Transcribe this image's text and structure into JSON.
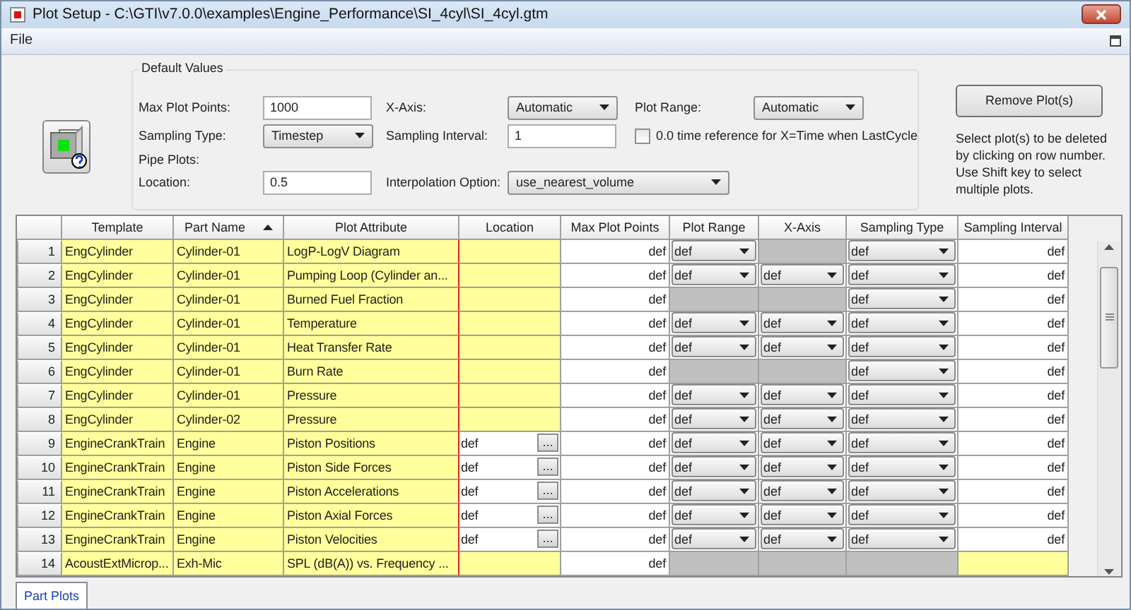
{
  "window": {
    "title": "Plot Setup - C:\\GTI\\v7.0.0\\examples\\Engine_Performance\\SI_4cyl\\SI_4cyl.gtm"
  },
  "menu": [
    "File"
  ],
  "default_values": {
    "title": "Default Values",
    "rows": [
      [
        {
          "kind": "input",
          "label": "Max Plot Points:",
          "value": "1000"
        },
        {
          "kind": "combo",
          "label": "X-Axis:",
          "value": "Automatic"
        },
        {
          "kind": "combo",
          "label": "Plot Range:",
          "value": "Automatic"
        }
      ],
      [
        {
          "kind": "combo",
          "label": "Sampling Type:",
          "value": "Timestep"
        },
        {
          "kind": "input",
          "label": "Sampling Interval:",
          "value": "1"
        },
        {
          "kind": "checkbox",
          "label": "0.0 time reference for X=Time when LastCycle",
          "checked": false
        }
      ],
      [
        {
          "kind": "heading",
          "label": "Pipe Plots:"
        }
      ],
      [
        {
          "kind": "input",
          "label": "Location:",
          "value": "0.5"
        },
        {
          "kind": "combo",
          "label": "Interpolation Option:",
          "value": "use_nearest_volume"
        }
      ]
    ]
  },
  "remove_button": "Remove Plot(s)",
  "help_text": "Select plot(s) to be deleted by clicking on row number. Use Shift key to select multiple plots.",
  "table": {
    "columns": [
      {
        "label": "Template",
        "sorted": false
      },
      {
        "label": "Part Name",
        "sorted": true
      },
      {
        "label": "Plot Attribute",
        "sorted": false
      },
      {
        "label": "Location",
        "sorted": false
      },
      {
        "label": "Max Plot Points",
        "sorted": false
      },
      {
        "label": "Plot Range",
        "sorted": false
      },
      {
        "label": "X-Axis",
        "sorted": false
      },
      {
        "label": "Sampling Type",
        "sorted": false
      },
      {
        "label": "Sampling Interval",
        "sorted": false
      }
    ],
    "rows": [
      {
        "number": "1",
        "cells": [
          {
            "kind": "text",
            "text": "EngCylinder"
          },
          {
            "kind": "text",
            "text": "Cylinder-01"
          },
          {
            "kind": "text",
            "text": "LogP-LogV Diagram"
          },
          {
            "kind": "empty"
          },
          {
            "kind": "number",
            "text": "def"
          },
          {
            "kind": "combo",
            "text": "def"
          },
          {
            "kind": "disabled"
          },
          {
            "kind": "combo",
            "text": "def"
          },
          {
            "kind": "number",
            "text": "def"
          }
        ]
      },
      {
        "number": "2",
        "cells": [
          {
            "kind": "text",
            "text": "EngCylinder"
          },
          {
            "kind": "text",
            "text": "Cylinder-01"
          },
          {
            "kind": "text",
            "text": "Pumping Loop (Cylinder an..."
          },
          {
            "kind": "empty"
          },
          {
            "kind": "number",
            "text": "def"
          },
          {
            "kind": "combo",
            "text": "def"
          },
          {
            "kind": "combo",
            "text": "def"
          },
          {
            "kind": "combo",
            "text": "def"
          },
          {
            "kind": "number",
            "text": "def"
          }
        ]
      },
      {
        "number": "3",
        "cells": [
          {
            "kind": "text",
            "text": "EngCylinder"
          },
          {
            "kind": "text",
            "text": "Cylinder-01"
          },
          {
            "kind": "text",
            "text": "Burned Fuel Fraction"
          },
          {
            "kind": "empty"
          },
          {
            "kind": "number",
            "text": "def"
          },
          {
            "kind": "disabled"
          },
          {
            "kind": "disabled"
          },
          {
            "kind": "combo",
            "text": "def"
          },
          {
            "kind": "number",
            "text": "def"
          }
        ]
      },
      {
        "number": "4",
        "cells": [
          {
            "kind": "text",
            "text": "EngCylinder"
          },
          {
            "kind": "text",
            "text": "Cylinder-01"
          },
          {
            "kind": "text",
            "text": "Temperature"
          },
          {
            "kind": "empty"
          },
          {
            "kind": "number",
            "text": "def"
          },
          {
            "kind": "combo",
            "text": "def"
          },
          {
            "kind": "combo",
            "text": "def"
          },
          {
            "kind": "combo",
            "text": "def"
          },
          {
            "kind": "number",
            "text": "def"
          }
        ]
      },
      {
        "number": "5",
        "cells": [
          {
            "kind": "text",
            "text": "EngCylinder"
          },
          {
            "kind": "text",
            "text": "Cylinder-01"
          },
          {
            "kind": "text",
            "text": "Heat Transfer Rate"
          },
          {
            "kind": "empty"
          },
          {
            "kind": "number",
            "text": "def"
          },
          {
            "kind": "combo",
            "text": "def"
          },
          {
            "kind": "combo",
            "text": "def"
          },
          {
            "kind": "combo",
            "text": "def"
          },
          {
            "kind": "number",
            "text": "def"
          }
        ]
      },
      {
        "number": "6",
        "cells": [
          {
            "kind": "text",
            "text": "EngCylinder"
          },
          {
            "kind": "text",
            "text": "Cylinder-01"
          },
          {
            "kind": "text",
            "text": "Burn Rate"
          },
          {
            "kind": "empty"
          },
          {
            "kind": "number",
            "text": "def"
          },
          {
            "kind": "disabled"
          },
          {
            "kind": "disabled"
          },
          {
            "kind": "combo",
            "text": "def"
          },
          {
            "kind": "number",
            "text": "def"
          }
        ]
      },
      {
        "number": "7",
        "cells": [
          {
            "kind": "text",
            "text": "EngCylinder"
          },
          {
            "kind": "text",
            "text": "Cylinder-01"
          },
          {
            "kind": "text",
            "text": "Pressure"
          },
          {
            "kind": "empty"
          },
          {
            "kind": "number",
            "text": "def"
          },
          {
            "kind": "combo",
            "text": "def"
          },
          {
            "kind": "combo",
            "text": "def"
          },
          {
            "kind": "combo",
            "text": "def"
          },
          {
            "kind": "number",
            "text": "def"
          }
        ]
      },
      {
        "number": "8",
        "cells": [
          {
            "kind": "text",
            "text": "EngCylinder"
          },
          {
            "kind": "text",
            "text": "Cylinder-02"
          },
          {
            "kind": "text",
            "text": "Pressure"
          },
          {
            "kind": "empty"
          },
          {
            "kind": "number",
            "text": "def"
          },
          {
            "kind": "combo",
            "text": "def"
          },
          {
            "kind": "combo",
            "text": "def"
          },
          {
            "kind": "combo",
            "text": "def"
          },
          {
            "kind": "number",
            "text": "def"
          }
        ]
      },
      {
        "number": "9",
        "cells": [
          {
            "kind": "text",
            "text": "EngineCrankTrain"
          },
          {
            "kind": "text",
            "text": "Engine"
          },
          {
            "kind": "text",
            "text": "Piston Positions"
          },
          {
            "kind": "browse",
            "text": "def",
            "button": "..."
          },
          {
            "kind": "number",
            "text": "def"
          },
          {
            "kind": "combo",
            "text": "def"
          },
          {
            "kind": "combo",
            "text": "def"
          },
          {
            "kind": "combo",
            "text": "def"
          },
          {
            "kind": "number",
            "text": "def"
          }
        ]
      },
      {
        "number": "10",
        "cells": [
          {
            "kind": "text",
            "text": "EngineCrankTrain"
          },
          {
            "kind": "text",
            "text": "Engine"
          },
          {
            "kind": "text",
            "text": "Piston Side Forces"
          },
          {
            "kind": "browse",
            "text": "def",
            "button": "..."
          },
          {
            "kind": "number",
            "text": "def"
          },
          {
            "kind": "combo",
            "text": "def"
          },
          {
            "kind": "combo",
            "text": "def"
          },
          {
            "kind": "combo",
            "text": "def"
          },
          {
            "kind": "number",
            "text": "def"
          }
        ]
      },
      {
        "number": "11",
        "cells": [
          {
            "kind": "text",
            "text": "EngineCrankTrain"
          },
          {
            "kind": "text",
            "text": "Engine"
          },
          {
            "kind": "text",
            "text": "Piston Accelerations"
          },
          {
            "kind": "browse",
            "text": "def",
            "button": "..."
          },
          {
            "kind": "number",
            "text": "def"
          },
          {
            "kind": "combo",
            "text": "def"
          },
          {
            "kind": "combo",
            "text": "def"
          },
          {
            "kind": "combo",
            "text": "def"
          },
          {
            "kind": "number",
            "text": "def"
          }
        ]
      },
      {
        "number": "12",
        "cells": [
          {
            "kind": "text",
            "text": "EngineCrankTrain"
          },
          {
            "kind": "text",
            "text": "Engine"
          },
          {
            "kind": "text",
            "text": "Piston Axial Forces"
          },
          {
            "kind": "browse",
            "text": "def",
            "button": "..."
          },
          {
            "kind": "number",
            "text": "def"
          },
          {
            "kind": "combo",
            "text": "def"
          },
          {
            "kind": "combo",
            "text": "def"
          },
          {
            "kind": "combo",
            "text": "def"
          },
          {
            "kind": "number",
            "text": "def"
          }
        ]
      },
      {
        "number": "13",
        "cells": [
          {
            "kind": "text",
            "text": "EngineCrankTrain"
          },
          {
            "kind": "text",
            "text": "Engine"
          },
          {
            "kind": "text",
            "text": "Piston Velocities"
          },
          {
            "kind": "browse",
            "text": "def",
            "button": "..."
          },
          {
            "kind": "number",
            "text": "def"
          },
          {
            "kind": "combo",
            "text": "def"
          },
          {
            "kind": "combo",
            "text": "def"
          },
          {
            "kind": "combo",
            "text": "def"
          },
          {
            "kind": "number",
            "text": "def"
          }
        ]
      },
      {
        "number": "14",
        "cells": [
          {
            "kind": "text",
            "text": "AcoustExtMicrop..."
          },
          {
            "kind": "text",
            "text": "Exh-Mic"
          },
          {
            "kind": "text",
            "text": "SPL (dB(A)) vs. Frequency ..."
          },
          {
            "kind": "empty"
          },
          {
            "kind": "number",
            "text": "def"
          },
          {
            "kind": "disabled"
          },
          {
            "kind": "disabled"
          },
          {
            "kind": "disabled"
          },
          {
            "kind": "empty"
          }
        ]
      }
    ]
  },
  "tabs": [
    {
      "label": "Part Plots",
      "selected": true
    }
  ]
}
